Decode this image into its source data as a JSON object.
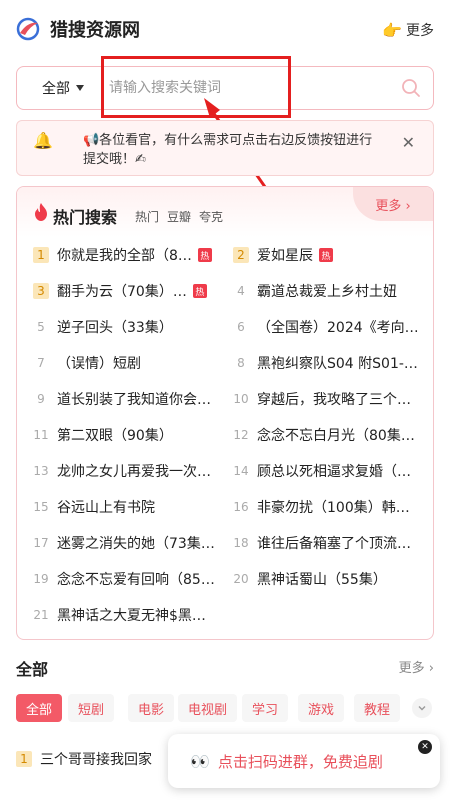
{
  "header": {
    "title": "猎搜资源网",
    "more_label": "更多",
    "more_icon": "👉",
    "brand_color": "#e8505b"
  },
  "search": {
    "category": "全部",
    "placeholder": "请输入搜索关键词"
  },
  "notice": {
    "icon": "🔔",
    "text": "📢各位看官，有什么需求可点击右边反馈按钮进行提交哦！✍",
    "close": "✕"
  },
  "hot": {
    "title": "热门搜索",
    "tabs": [
      "热门",
      "豆瓣",
      "夸克"
    ],
    "more_label": "更多 ›",
    "badge": "热",
    "items": [
      {
        "rank": "1",
        "text": "你就是我的全部（8…",
        "hot": true
      },
      {
        "rank": "2",
        "text": "爱如星辰",
        "hot": true
      },
      {
        "rank": "3",
        "text": "翻手为云（70集）…",
        "hot": true
      },
      {
        "rank": "4",
        "text": "霸道总裁爱上乡村土妞",
        "hot": false
      },
      {
        "rank": "5",
        "text": "逆子回头（33集）",
        "hot": false
      },
      {
        "rank": "6",
        "text": "（全国卷）2024《考向…",
        "hot": false
      },
      {
        "rank": "7",
        "text": "（误情）短剧",
        "hot": false
      },
      {
        "rank": "8",
        "text": "黑袍纠察队S04 附S01-…",
        "hot": false
      },
      {
        "rank": "9",
        "text": "道长别装了我知道你会…",
        "hot": false
      },
      {
        "rank": "10",
        "text": "穿越后，我攻略了三个…",
        "hot": false
      },
      {
        "rank": "11",
        "text": "第二双眼（90集）",
        "hot": false
      },
      {
        "rank": "12",
        "text": "念念不忘白月光（80集…",
        "hot": false
      },
      {
        "rank": "13",
        "text": "龙帅之女儿再爱我一次…",
        "hot": false
      },
      {
        "rank": "14",
        "text": "顾总以死相逼求复婚（…",
        "hot": false
      },
      {
        "rank": "15",
        "text": "谷远山上有书院",
        "hot": false
      },
      {
        "rank": "16",
        "text": "非豪勿扰（100集）韩…",
        "hot": false
      },
      {
        "rank": "17",
        "text": "迷雾之消失的她（73集…",
        "hot": false
      },
      {
        "rank": "18",
        "text": "谁往后备箱塞了个顶流…",
        "hot": false
      },
      {
        "rank": "19",
        "text": "念念不忘爱有回响（85…",
        "hot": false
      },
      {
        "rank": "20",
        "text": "黑神话蜀山（55集）",
        "hot": false
      },
      {
        "rank": "21",
        "text": "黑神话之大夏无神$黑…",
        "hot": false
      }
    ]
  },
  "all_section": {
    "title": "全部",
    "more_label": "更多 ›",
    "chips": [
      "全部",
      "短剧",
      "电影",
      "电视剧",
      "学习",
      "游戏",
      "教程"
    ],
    "active_chip": "全部",
    "first_item": {
      "rank": "1",
      "text": "三个哥哥接我回家"
    }
  },
  "float_banner": {
    "icon": "👀",
    "text": "点击扫码进群，免费追剧",
    "close": "✕"
  },
  "annotation_color": "#e41f1f"
}
